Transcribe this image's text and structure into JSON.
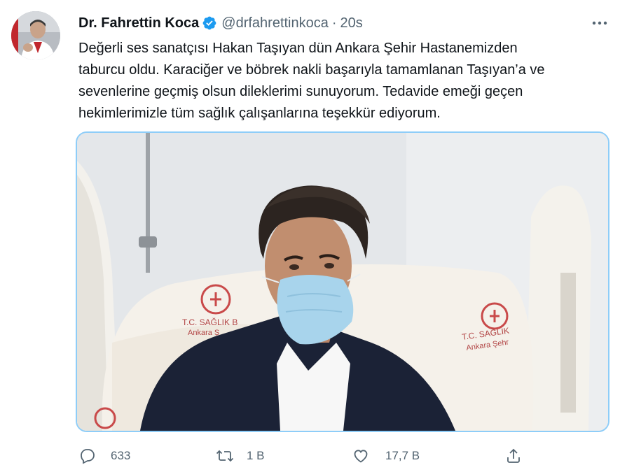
{
  "author": {
    "name": "Dr. Fahrettin Koca",
    "handle": "@drfahrettinkoca",
    "separator": "·",
    "time": "20s"
  },
  "tweet": {
    "lines": [
      "Değerli ses sanatçısı Hakan Taşıyan dün Ankara Şehir Hastanemizden",
      "taburcu oldu. Karaciğer ve böbrek nakli başarıyla tamamlanan Taşıyan’a ve",
      "sevenlerine geçmiş olsun dileklerimi sunuyorum. Tedavide emeği geçen",
      "hekimlerimizle tüm sağlık çalışanlarına teşekkür ediyorum."
    ]
  },
  "media": {
    "pillow_text_left_1": "T.C. SAĞLIK B",
    "pillow_text_left_2": "Ankara Ş",
    "pillow_text_right_1": "T.C. SAĞLIK",
    "pillow_text_right_2": "Ankara Şehr"
  },
  "actions": {
    "reply_count": "633",
    "retweet_count": "1 B",
    "like_count": "17,7 B"
  },
  "icons": {
    "verified": "verified-badge-icon",
    "more": "more-icon",
    "reply": "reply-icon",
    "retweet": "retweet-icon",
    "like": "heart-icon",
    "share": "share-icon"
  },
  "colors": {
    "accent": "#1d9bf0",
    "muted": "#536471",
    "media_border": "#8ecdf8"
  }
}
